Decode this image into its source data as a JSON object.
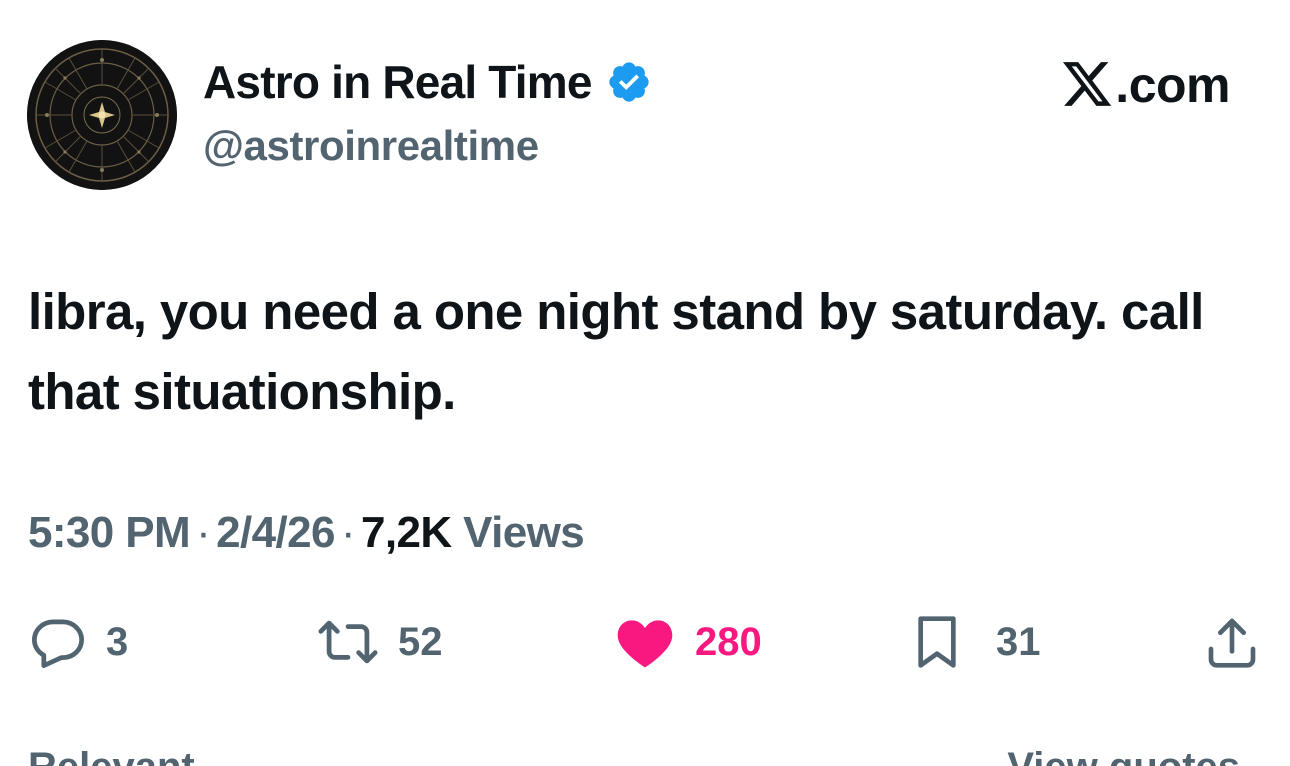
{
  "author": {
    "display_name": "Astro in Real Time",
    "handle": "@astroinrealtime",
    "verified": true,
    "avatar_icon": "zodiac-wheel-icon"
  },
  "brand": {
    "icon": "x-logo-icon",
    "domain": ".com"
  },
  "tweet": {
    "text": "libra, you need a one night stand by saturday. call that situationship."
  },
  "meta": {
    "time": "5:30 PM",
    "separator": "·",
    "date": "2/4/26",
    "views_count": "7,2K",
    "views_label": "Views"
  },
  "actions": {
    "replies": "3",
    "reposts": "52",
    "likes": "280",
    "bookmarks": "31"
  },
  "footer": {
    "relevant_label": "Relevant",
    "quotes_label": "View quotes"
  },
  "colors": {
    "text_primary": "#0f1419",
    "text_secondary": "#536471",
    "like_active": "#f91880",
    "verified_blue": "#1d9bf0"
  }
}
